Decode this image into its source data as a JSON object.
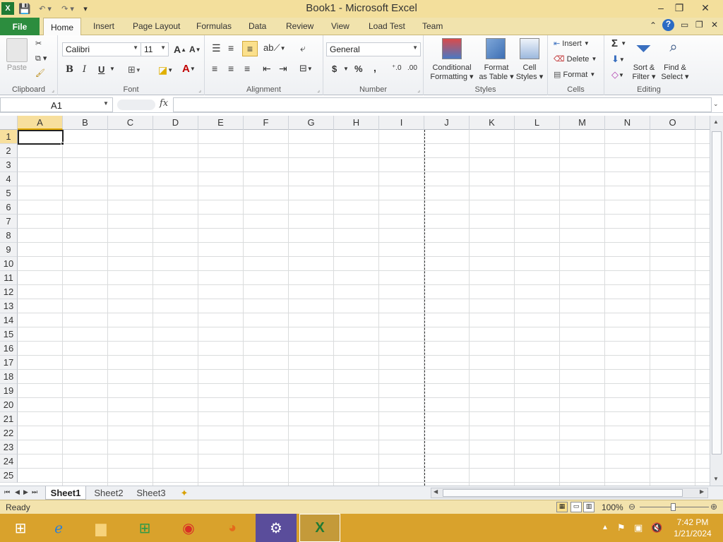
{
  "window": {
    "title": "Book1  -  Microsoft Excel",
    "minimize": "–",
    "restore": "❐",
    "close": "✕"
  },
  "tabs": {
    "file": "File",
    "items": [
      "Home",
      "Insert",
      "Page Layout",
      "Formulas",
      "Data",
      "Review",
      "View",
      "Load Test",
      "Team"
    ]
  },
  "ribbon": {
    "clipboard": {
      "label": "Clipboard",
      "paste": "Paste"
    },
    "font": {
      "label": "Font",
      "name": "Calibri",
      "size": "11",
      "bold": "B",
      "italic": "I",
      "underline": "U"
    },
    "alignment": {
      "label": "Alignment"
    },
    "number": {
      "label": "Number",
      "format": "General",
      "currency": "$",
      "percent": "%",
      "comma": ","
    },
    "styles": {
      "label": "Styles",
      "conditional": [
        "Conditional",
        "Formatting"
      ],
      "format_table": [
        "Format",
        "as Table"
      ],
      "cell_styles": [
        "Cell",
        "Styles"
      ]
    },
    "cells": {
      "label": "Cells",
      "insert": "Insert",
      "delete": "Delete",
      "format": "Format"
    },
    "editing": {
      "label": "Editing",
      "sort": [
        "Sort &",
        "Filter"
      ],
      "find": [
        "Find &",
        "Select"
      ],
      "sum": "Σ"
    }
  },
  "formula_bar": {
    "name_box": "A1",
    "fx": "fx",
    "value": ""
  },
  "grid": {
    "columns": [
      "A",
      "B",
      "C",
      "D",
      "E",
      "F",
      "G",
      "H",
      "I",
      "J",
      "K",
      "L",
      "M",
      "N",
      "O"
    ],
    "rows": [
      "1",
      "2",
      "3",
      "4",
      "5",
      "6",
      "7",
      "8",
      "9",
      "10",
      "11",
      "12",
      "13",
      "14",
      "15",
      "16",
      "17",
      "18",
      "19",
      "20",
      "21",
      "22",
      "23",
      "24",
      "25"
    ],
    "selected": "A1"
  },
  "sheets": [
    "Sheet1",
    "Sheet2",
    "Sheet3"
  ],
  "active_sheet": "Sheet1",
  "status": {
    "text": "Ready",
    "zoom": "100%"
  },
  "taskbar": {
    "time": "7:42 PM",
    "date": "1/21/2024"
  },
  "colors": {
    "titlebar": "#f3df9c",
    "file_tab": "#2c8d3e",
    "taskbar": "#d9a22c"
  }
}
